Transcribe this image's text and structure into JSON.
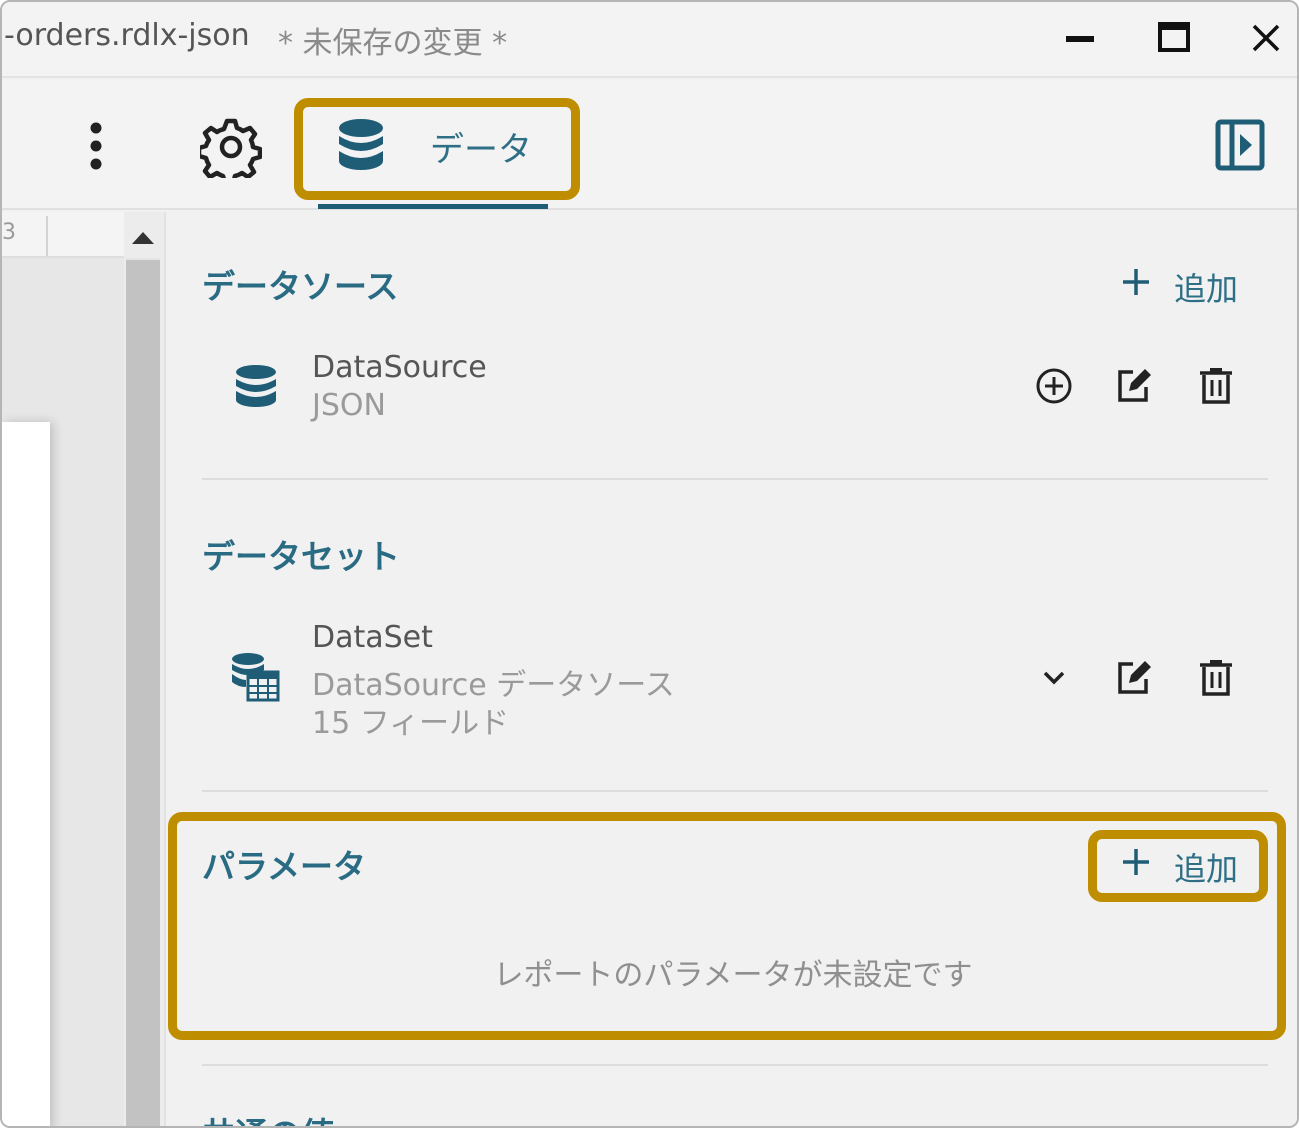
{
  "window": {
    "file_name": "-orders.rdlx-json",
    "unsaved_label": "* 未保存の変更 *",
    "controls": [
      "minimize-icon",
      "maximize-icon",
      "close-icon"
    ]
  },
  "toolbar": {
    "more_icon": "kebab-icon",
    "settings_icon": "gear-icon",
    "data_tab_label": "データ",
    "panel_toggle_icon": "panel-toggle-icon"
  },
  "ruler": {
    "number": "3"
  },
  "panel": {
    "data_sources": {
      "title": "データソース",
      "add_label": "追加",
      "items": [
        {
          "name": "DataSource",
          "type": "JSON"
        }
      ]
    },
    "datasets": {
      "title": "データセット",
      "items": [
        {
          "name": "DataSet",
          "source": "DataSource データソース",
          "fields": "15 フィールド"
        }
      ]
    },
    "parameters": {
      "title": "パラメータ",
      "add_label": "追加",
      "empty_message": "レポートのパラメータが未設定です"
    },
    "common_values": {
      "title": "共通の値"
    }
  },
  "colors": {
    "accent": "#2a6b84",
    "tab_underline": "#1f5d76",
    "highlight": "#bf8e00"
  }
}
